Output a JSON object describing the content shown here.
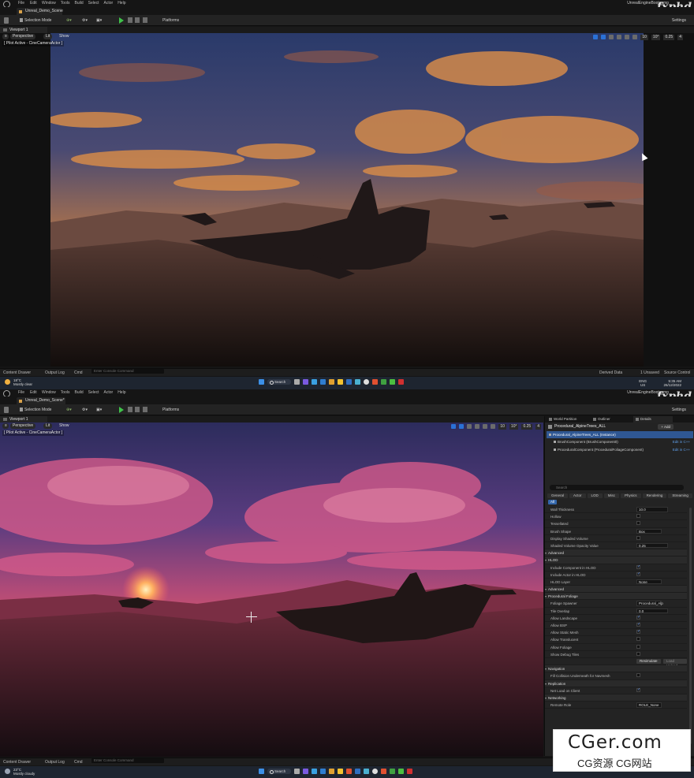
{
  "app": {
    "menus": [
      "File",
      "Edit",
      "Window",
      "Tools",
      "Build",
      "Select",
      "Actor",
      "Help"
    ],
    "project_name": "UnrealEngineBootcamp",
    "watermark": "fxphd"
  },
  "top": {
    "doc_tab": "Unreal_Demo_Scene",
    "toolbar": {
      "selection_mode": "Selection Mode",
      "platforms": "Platforms",
      "settings": "Settings"
    },
    "viewport_tab": "Viewport 1",
    "viewport": {
      "perspective": "Perspective",
      "lit": "Lit",
      "show": "Show",
      "pilot": "[ Pilot Active - CineCameraActor ]",
      "grid": "10",
      "angle": "10°",
      "scale": "0.25",
      "cams": "4"
    },
    "status": {
      "content_drawer": "Content Drawer",
      "output_log": "Output Log",
      "cmd": "Cmd",
      "console_placeholder": "Enter Console Command",
      "derived_data": "Derived Data",
      "unsaved": "1 Unsaved",
      "source_control": "Source Control"
    },
    "taskbar": {
      "temp": "18°C",
      "weather": "Mostly clear",
      "search": "Search",
      "lang": "ENG",
      "lang2": "US",
      "time": "5:35 AM",
      "date": "26/12/2022"
    }
  },
  "bottom": {
    "doc_tab": "Unreal_Demo_Scene*",
    "toolbar": {
      "selection_mode": "Selection Mode",
      "platforms": "Platforms",
      "settings": "Settings"
    },
    "viewport_tab": "Viewport 1",
    "viewport": {
      "perspective": "Perspective",
      "lit": "Lit",
      "show": "Show",
      "pilot": "[ Pilot Active - CineCameraActor ]",
      "grid": "10",
      "angle": "10°",
      "scale": "0.25",
      "cams": "4"
    },
    "panel": {
      "tabs": [
        "World Partition",
        "Outliner",
        "Details"
      ],
      "title": "Procedural_AlpineTrees_ALL",
      "add": "+ Add",
      "components": [
        {
          "label": "Procedural_AlpineTrees_ALL (Instance)",
          "edit": ""
        },
        {
          "label": "BrushComponent (BrushComponent0)",
          "edit": "Edit in C++"
        },
        {
          "label": "ProceduralComponent (ProceduralFoliageComponent)",
          "edit": "Edit in C++"
        }
      ],
      "search_placeholder": "Search",
      "filters": [
        "General",
        "Actor",
        "LOD",
        "Misc",
        "Physics",
        "Rendering",
        "Streaming"
      ],
      "all": "All",
      "rows": [
        {
          "label": "Wall Thickness",
          "type": "box",
          "value": "10.0"
        },
        {
          "label": "Hollow",
          "type": "chk",
          "value": ""
        },
        {
          "label": "Tessellated",
          "type": "chk",
          "value": ""
        },
        {
          "label": "Brush Shape",
          "type": "dd",
          "value": "Box"
        },
        {
          "label": "Display Shaded Volume",
          "type": "chk",
          "value": ""
        },
        {
          "label": "Shaded Volume Opacity Value",
          "type": "box",
          "value": "0.25"
        },
        {
          "label": "Advanced",
          "type": "sec",
          "value": ""
        },
        {
          "label": "HLOD",
          "type": "sec",
          "value": ""
        },
        {
          "label": "Include Component in HLOD",
          "type": "chkon",
          "value": ""
        },
        {
          "label": "Include Actor in HLOD",
          "type": "chkon",
          "value": ""
        },
        {
          "label": "HLOD Layer",
          "type": "dd",
          "value": "None"
        },
        {
          "label": "Advanced",
          "type": "sec",
          "value": ""
        },
        {
          "label": "Procedural Foliage",
          "type": "sec",
          "value": ""
        },
        {
          "label": "Foliage Spawner",
          "type": "dd",
          "value": "Procedural_Alp"
        },
        {
          "label": "Tile Overlap",
          "type": "box",
          "value": "0.0"
        },
        {
          "label": "Allow Landscape",
          "type": "chkon",
          "value": ""
        },
        {
          "label": "Allow BSP",
          "type": "chkon",
          "value": ""
        },
        {
          "label": "Allow Static Mesh",
          "type": "chkon",
          "value": ""
        },
        {
          "label": "Allow Translucent",
          "type": "chk",
          "value": ""
        },
        {
          "label": "Allow Foliage",
          "type": "chk",
          "value": ""
        },
        {
          "label": "Show Debug Tiles",
          "type": "chk",
          "value": ""
        },
        {
          "label": "",
          "type": "btn",
          "value": "Resimulate"
        },
        {
          "label": "Navigation",
          "type": "sec",
          "value": ""
        },
        {
          "label": "Fill Collision Underneath for Navmesh",
          "type": "chk",
          "value": ""
        },
        {
          "label": "Replication",
          "type": "sec",
          "value": ""
        },
        {
          "label": "Net Load on Client",
          "type": "chkon",
          "value": ""
        },
        {
          "label": "Networking",
          "type": "sec",
          "value": ""
        },
        {
          "label": "Remote Role",
          "type": "dd",
          "value": "ROLE_None"
        }
      ],
      "load_more": "Load Unload"
    },
    "status": {
      "content_drawer": "Content Drawer",
      "output_log": "Output Log",
      "cmd": "Cmd",
      "console_placeholder": "Enter Console Command"
    },
    "taskbar": {
      "temp": "23°C",
      "weather": "Mostly cloudy",
      "search": "Search",
      "date": "25/12/2022"
    }
  },
  "overlay": {
    "site": "CGer.com",
    "site_sub": "CG资源 CG网站"
  }
}
